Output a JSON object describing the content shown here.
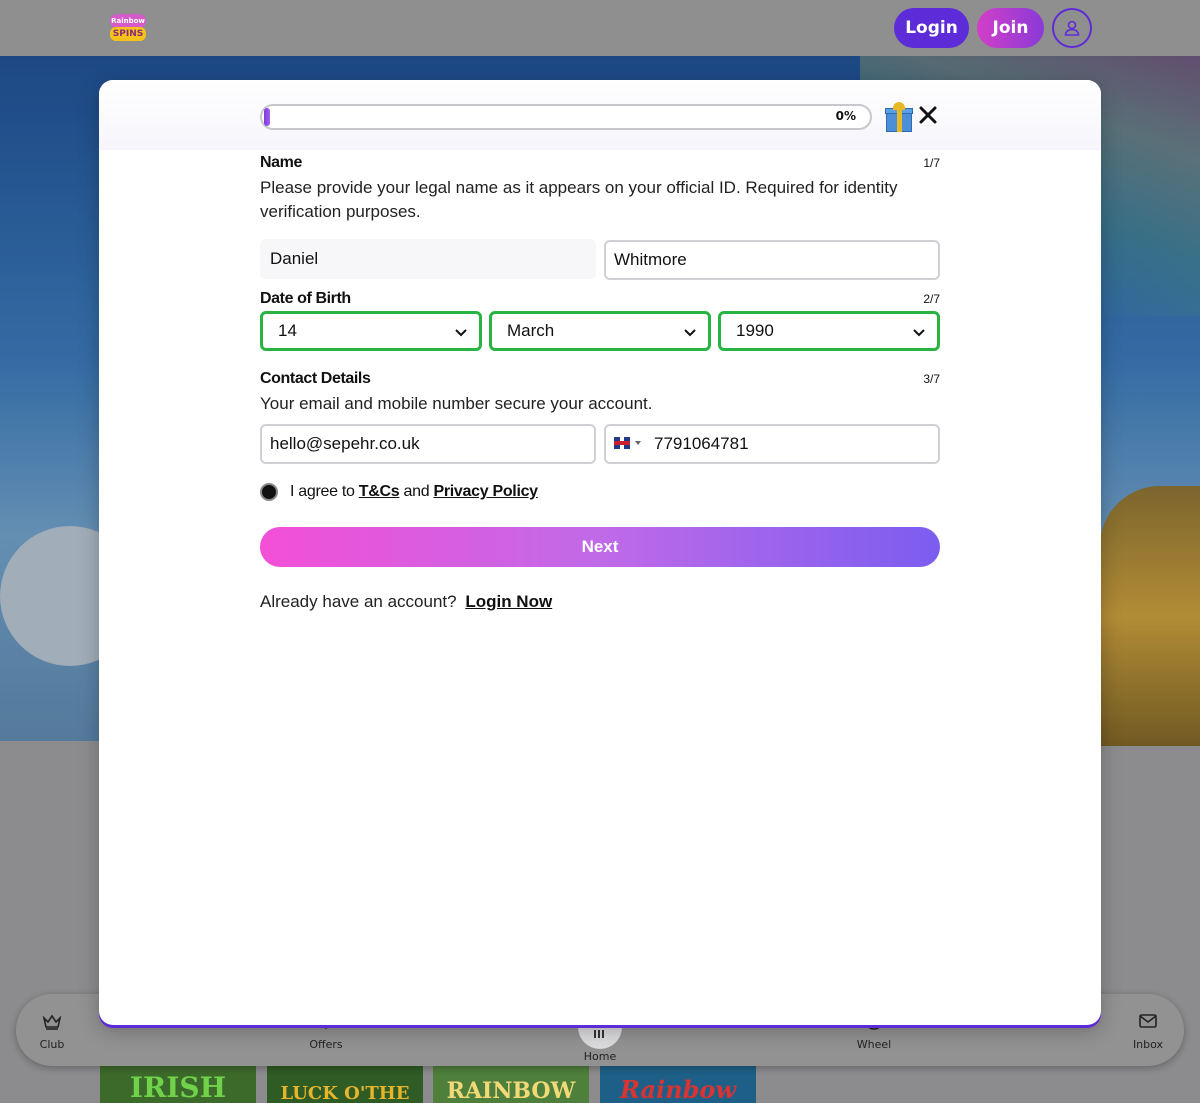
{
  "header": {
    "logo_text_top": "Rainbow",
    "logo_text_bottom": "SPINS",
    "login_label": "Login",
    "join_label": "Join",
    "profile_icon": "user-icon"
  },
  "modal": {
    "progress": {
      "percent_label": "0%",
      "value": 0
    },
    "gift_icon": "gift-icon",
    "close_icon": "close-icon",
    "name_section": {
      "title": "Name",
      "step": "1/7",
      "description": "Please provide your legal name as it appears on your official ID. Required for identity verification purposes.",
      "first_name": "Daniel",
      "last_name": "Whitmore"
    },
    "dob_section": {
      "title": "Date of Birth",
      "step": "2/7",
      "day": "14",
      "month": "March",
      "year": "1990"
    },
    "contact_section": {
      "title": "Contact Details",
      "step": "3/7",
      "description": "Your email and mobile number secure your account.",
      "email": "hello@sepehr.co.uk",
      "phone": "7791064781",
      "country_flag": "uk-flag-icon"
    },
    "agree": {
      "prefix": "I agree to",
      "tcs_link": "T&Cs",
      "and": "and",
      "privacy_link": "Privacy Policy"
    },
    "next_label": "Next",
    "already_text": "Already have an account?",
    "login_now_link": "Login Now"
  },
  "bottom_nav": {
    "items": [
      {
        "label": "Club",
        "icon": "crown-icon"
      },
      {
        "label": "Offers",
        "icon": "tag-icon"
      },
      {
        "label": "Home",
        "icon": "home-icon"
      },
      {
        "label": "Wheel",
        "icon": "wheel-icon"
      },
      {
        "label": "Inbox",
        "icon": "mail-icon"
      }
    ]
  },
  "games": [
    "IRISH",
    "LUCK O'THE",
    "RAINBOW",
    "Rainbow"
  ],
  "colors": {
    "accent_purple": "#5d2bd7",
    "select_border_green": "#28b443",
    "next_gradient_start": "#f34fd6",
    "next_gradient_end": "#7b5df0"
  }
}
